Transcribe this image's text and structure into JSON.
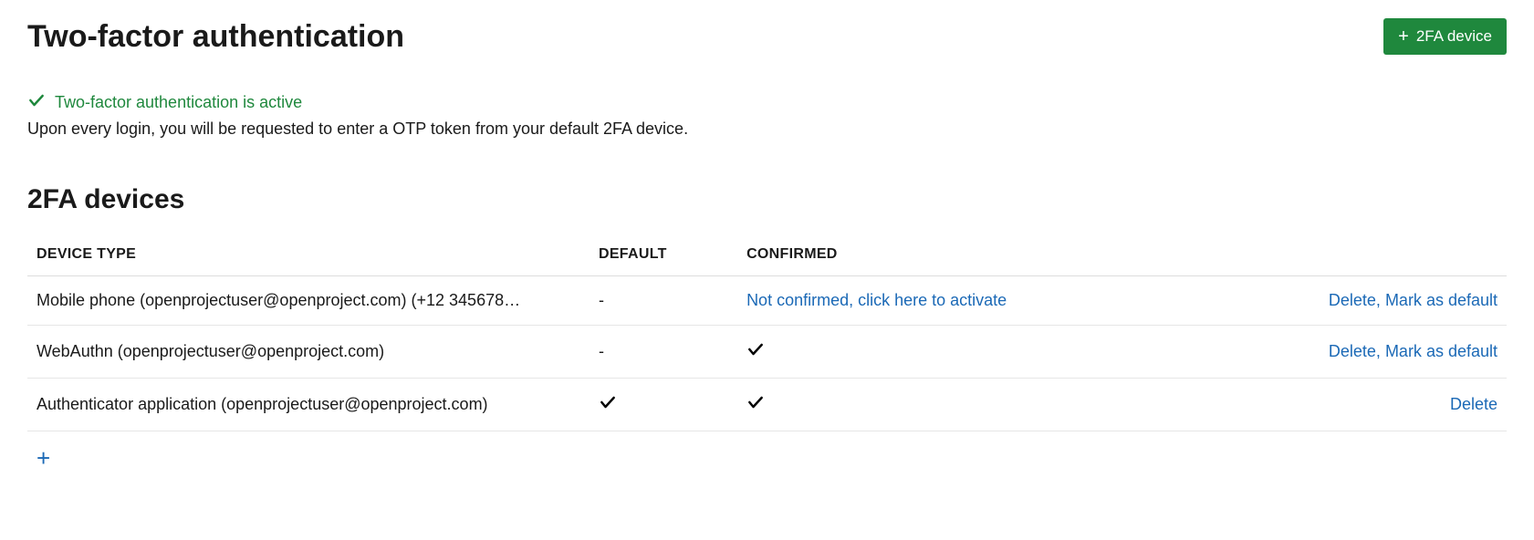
{
  "header": {
    "title": "Two-factor authentication",
    "add_button_label": "2FA device"
  },
  "status": {
    "active_text": "Two-factor authentication is active",
    "description": "Upon every login, you will be requested to enter a OTP token from your default 2FA device."
  },
  "section": {
    "title": "2FA devices"
  },
  "table": {
    "headers": {
      "device_type": "DEVICE TYPE",
      "default": "DEFAULT",
      "confirmed": "CONFIRMED"
    }
  },
  "devices": [
    {
      "name": "Mobile phone (openprojectuser@openproject.com) (+12 345678…",
      "default_text": "-",
      "default_check": false,
      "confirmed_text": "Not confirmed, click here to activate",
      "confirmed_check": false,
      "confirmed_link": true,
      "actions": {
        "delete": "Delete",
        "mark_default": "Mark as default"
      }
    },
    {
      "name": "WebAuthn (openprojectuser@openproject.com)",
      "default_text": "-",
      "default_check": false,
      "confirmed_text": "",
      "confirmed_check": true,
      "confirmed_link": false,
      "actions": {
        "delete": "Delete",
        "mark_default": "Mark as default"
      }
    },
    {
      "name": "Authenticator application (openprojectuser@openproject.com)",
      "default_text": "",
      "default_check": true,
      "confirmed_text": "",
      "confirmed_check": true,
      "confirmed_link": false,
      "actions": {
        "delete": "Delete",
        "mark_default": ""
      }
    }
  ]
}
